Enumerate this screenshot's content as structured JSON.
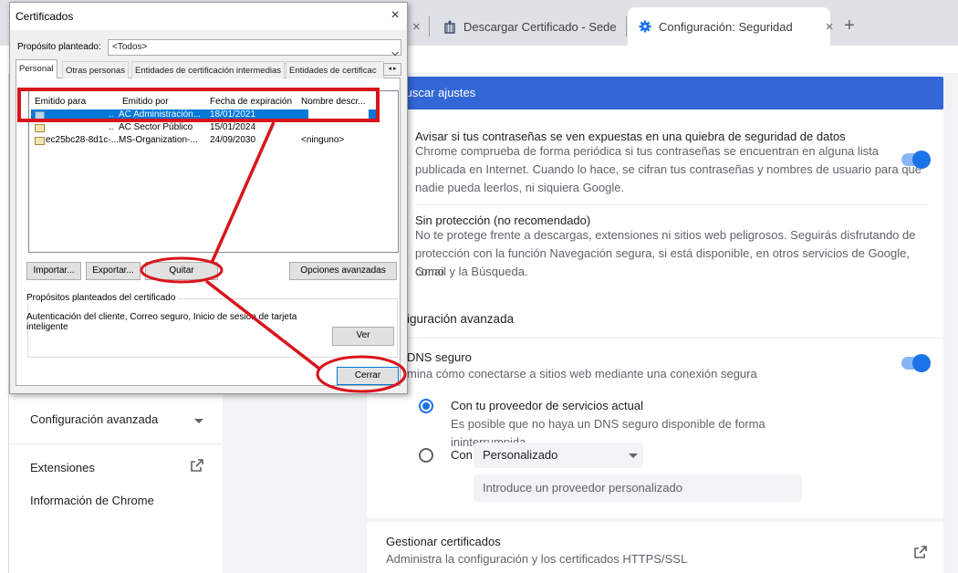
{
  "browser": {
    "tabs": [
      {
        "title": "Descargar Certificado - Sede",
        "close": "×"
      },
      {
        "title": "Configuración: Seguridad",
        "close": "×"
      }
    ],
    "partial_tab_close": "×",
    "new_tab": "+"
  },
  "settings": {
    "search_placeholder": "Buscar ajustes",
    "breach_alert": {
      "title": "Avisar si tus contraseñas se ven expuestas en una quiebra de seguridad de datos",
      "desc1": "Chrome comprueba de forma periódica si tus contraseñas se encuentran en alguna lista",
      "desc2": "publicada en Internet. Cuando lo hace, se cifran tus contraseñas y nombres de usuario para que",
      "desc3": "nadie pueda leerlos, ni siquiera Google.",
      "enabled": true
    },
    "no_protection": {
      "title": "Sin protección (no recomendado)",
      "desc1": "No te protege frente a descargas, extensiones ni sitios web peligrosos. Seguirás disfrutando de",
      "desc2": "protección con la función Navegación segura, si está disponible, en otros servicios de Google, como",
      "desc3": "Gmail y la Búsqueda."
    },
    "advanced_heading": "iguración avanzada",
    "secure_dns": {
      "title": "DNS seguro",
      "desc": "mina cómo conectarse a sitios web mediante una conexión segura",
      "enabled": true,
      "option_current": "Con tu proveedor de servicios actual",
      "option_current_desc": "Es posible que no haya un DNS seguro disponible de forma ininterrumpida",
      "option_custom_prefix": "Con",
      "custom_select": "Personalizado",
      "custom_input_placeholder": "Introduce un proveedor personalizado"
    },
    "manage_certs": {
      "title": "Gestionar certificados",
      "desc": "Administra la configuración y los certificados HTTPS/SSL"
    },
    "sidebar": {
      "advanced": "Configuración avanzada",
      "extensions": "Extensiones",
      "about": "Información de Chrome"
    }
  },
  "dialog": {
    "title": "Certificados",
    "close": "×",
    "purpose_label": "Propósito planteado:",
    "purpose_value": "<Todos>",
    "tabs": [
      "Personal",
      "Otras personas",
      "Entidades de certificación intermedias",
      "Entidades de certificac"
    ],
    "scroll_arrows": "◂ ▸",
    "columns": [
      "Emitido para",
      "Emitido por",
      "Fecha de expiración",
      "Nombre descr..."
    ],
    "rows": [
      {
        "to": "",
        "by": "AC Administración...",
        "exp": "18/01/2021",
        "name": ""
      },
      {
        "to": "",
        "by": "AC Sector Público",
        "exp": "15/01/2024",
        "name": ""
      },
      {
        "to": "ec25bc28-8d1c-...",
        "by": "MS-Organization-...",
        "exp": "24/09/2030",
        "name": "<ninguno>"
      }
    ],
    "row_ellipsis": "..",
    "buttons": {
      "import": "Importar...",
      "export": "Exportar...",
      "remove": "Quitar",
      "advanced": "Opciones avanzadas",
      "view": "Ver",
      "close": "Cerrar"
    },
    "purposes_group_title": "Propósitos planteados del certificado",
    "purposes_text1": "Autenticación del cliente, Correo seguro, Inicio de sesión de tarjeta",
    "purposes_text2": "inteligente"
  },
  "colors": {
    "annotation_red": "#d9141c",
    "chrome_blue": "#1a73e8",
    "search_blue": "#3367d6",
    "selection_blue": "#0078d7"
  }
}
